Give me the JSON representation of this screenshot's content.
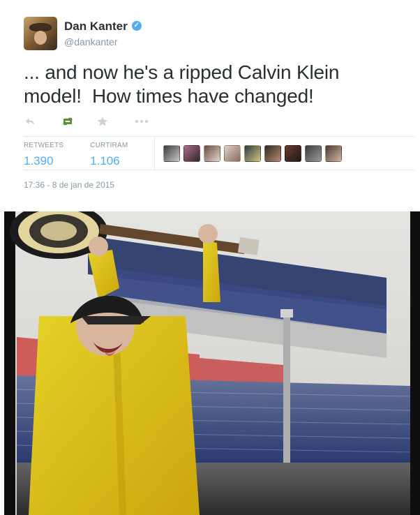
{
  "tweet": {
    "author": {
      "name": "Dan Kanter",
      "handle": "@dankanter",
      "verified_badge_icon": "check-icon"
    },
    "text": "... and now he's a ripped Calvin Klein\nmodel!  How times have changed!",
    "actions": {
      "reply_icon": "reply-icon",
      "retweet_icon": "retweet-icon",
      "favorite_icon": "star-icon",
      "more_icon": "more-icon"
    },
    "stats": {
      "retweets_label": "RETWEETS",
      "retweets_value": "1.390",
      "favorites_label": "CURTIRAM",
      "favorites_value": "1.106"
    },
    "timestamp": "17:36 - 8 de jan de 2015",
    "colors": {
      "text": "#292f33",
      "muted": "#8899a6",
      "accent": "#55acee",
      "retweet_green": "#5c913b",
      "divider": "#e1e8ed"
    }
  }
}
